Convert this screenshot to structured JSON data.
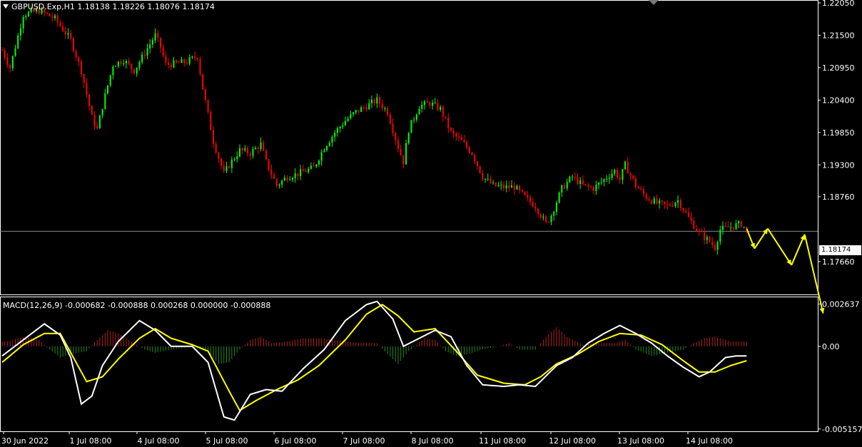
{
  "header": {
    "symbol_line": "GBPUSD.Exp,H1  1.18138 1.18226 1.18076 1.18174"
  },
  "macd_header": "MACD(12,26,9) -0.000682 -0.000888 0.000268 0.000000 -0.000888",
  "current_price_label": "1.18174",
  "colors": {
    "background": "#000000",
    "bull": "#00ff00",
    "bear": "#ff0000",
    "grid_frame": "#ffffff",
    "macd_line": "#ffffff",
    "signal_line": "#ffff00",
    "hist_pos": "#b22222",
    "hist_neg": "#228b22",
    "projection": "#ffff00"
  },
  "chart_data": [
    {
      "type": "candlestick",
      "title": "GBPUSD.Exp,H1",
      "y_ticks": [
        "1.22050",
        "1.21500",
        "1.20950",
        "1.20400",
        "1.19850",
        "1.19300",
        "1.18760",
        "1.17660"
      ],
      "ylim": [
        1.1715,
        1.2205
      ],
      "x_ticks": [
        "30 Jun 2022",
        "1 Jul 08:00",
        "4 Jul 08:00",
        "5 Jul 08:00",
        "6 Jul 08:00",
        "7 Jul 08:00",
        "8 Jul 08:00",
        "11 Jul 08:00",
        "12 Jul 08:00",
        "13 Jul 08:00",
        "14 Jul 08:00"
      ],
      "current_price": 1.18174,
      "close_path": [
        [
          0,
          1.2125
        ],
        [
          3,
          1.2095
        ],
        [
          8,
          1.2185
        ],
        [
          14,
          1.2192
        ],
        [
          20,
          1.2178
        ],
        [
          26,
          1.2142
        ],
        [
          30,
          1.209
        ],
        [
          34,
          1.201
        ],
        [
          36,
          1.199
        ],
        [
          38,
          1.203
        ],
        [
          42,
          1.21
        ],
        [
          46,
          1.2108
        ],
        [
          50,
          1.209
        ],
        [
          54,
          1.212
        ],
        [
          58,
          1.215
        ],
        [
          60,
          1.213
        ],
        [
          62,
          1.21
        ],
        [
          66,
          1.2102
        ],
        [
          70,
          1.2105
        ],
        [
          74,
          1.2115
        ],
        [
          76,
          1.206
        ],
        [
          80,
          1.197
        ],
        [
          84,
          1.1915
        ],
        [
          86,
          1.193
        ],
        [
          90,
          1.1955
        ],
        [
          94,
          1.195
        ],
        [
          98,
          1.1965
        ],
        [
          100,
          1.1935
        ],
        [
          104,
          1.1895
        ],
        [
          108,
          1.191
        ],
        [
          112,
          1.1915
        ],
        [
          118,
          1.1925
        ],
        [
          122,
          1.196
        ],
        [
          126,
          1.1985
        ],
        [
          130,
          1.2005
        ],
        [
          134,
          1.202
        ],
        [
          138,
          1.203
        ],
        [
          142,
          1.204
        ],
        [
          146,
          1.202
        ],
        [
          150,
          1.196
        ],
        [
          152,
          1.1935
        ],
        [
          154,
          1.199
        ],
        [
          158,
          1.203
        ],
        [
          162,
          1.2035
        ],
        [
          166,
          1.2025
        ],
        [
          170,
          1.1985
        ],
        [
          174,
          1.197
        ],
        [
          178,
          1.195
        ],
        [
          182,
          1.191
        ],
        [
          186,
          1.1895
        ],
        [
          190,
          1.1892
        ],
        [
          194,
          1.1893
        ],
        [
          198,
          1.1875
        ],
        [
          202,
          1.186
        ],
        [
          206,
          1.183
        ],
        [
          208,
          1.1845
        ],
        [
          212,
          1.189
        ],
        [
          216,
          1.191
        ],
        [
          220,
          1.1895
        ],
        [
          224,
          1.189
        ],
        [
          228,
          1.1905
        ],
        [
          232,
          1.192
        ],
        [
          234,
          1.1905
        ],
        [
          236,
          1.193
        ],
        [
          240,
          1.1895
        ],
        [
          244,
          1.1875
        ],
        [
          248,
          1.1865
        ],
        [
          252,
          1.186
        ],
        [
          256,
          1.187
        ],
        [
          260,
          1.184
        ],
        [
          264,
          1.1815
        ],
        [
          268,
          1.18
        ],
        [
          270,
          1.179
        ],
        [
          272,
          1.182
        ],
        [
          276,
          1.1825
        ],
        [
          280,
          1.183
        ],
        [
          282,
          1.182
        ]
      ],
      "projection_points": [
        [
          282,
          1.1822
        ],
        [
          285,
          1.1788
        ],
        [
          290,
          1.1822
        ],
        [
          299,
          1.176
        ],
        [
          304,
          1.1812
        ],
        [
          311,
          1.1678
        ]
      ]
    },
    {
      "type": "line",
      "title": "MACD(12,26,9)",
      "y_ticks": [
        "0.002637",
        "0.00",
        "-0.005157"
      ],
      "ylim": [
        -0.0053,
        0.0031
      ],
      "series": [
        {
          "name": "MACD",
          "values": [
            [
              0,
              -0.0006
            ],
            [
              8,
              0.0004
            ],
            [
              16,
              0.0014
            ],
            [
              22,
              0.0007
            ],
            [
              26,
              -0.0007
            ],
            [
              30,
              -0.0036
            ],
            [
              34,
              -0.0031
            ],
            [
              38,
              -0.0012
            ],
            [
              44,
              0.0003
            ],
            [
              52,
              0.0016
            ],
            [
              58,
              0.001
            ],
            [
              64,
              0.0
            ],
            [
              72,
              0.0
            ],
            [
              78,
              -0.001
            ],
            [
              84,
              -0.0044
            ],
            [
              88,
              -0.0046
            ],
            [
              94,
              -0.003
            ],
            [
              100,
              -0.0027
            ],
            [
              106,
              -0.0028
            ],
            [
              114,
              -0.0014
            ],
            [
              122,
              -0.0002
            ],
            [
              130,
              0.0016
            ],
            [
              138,
              0.0026
            ],
            [
              142,
              0.0028
            ],
            [
              148,
              0.0017
            ],
            [
              152,
              0.0
            ],
            [
              158,
              0.0005
            ],
            [
              164,
              0.001
            ],
            [
              170,
              0.0006
            ],
            [
              176,
              -0.0012
            ],
            [
              182,
              -0.0024
            ],
            [
              190,
              -0.0025
            ],
            [
              196,
              -0.0024
            ],
            [
              202,
              -0.0025
            ],
            [
              210,
              -0.0012
            ],
            [
              216,
              -0.0007
            ],
            [
              222,
              0.0002
            ],
            [
              228,
              0.0008
            ],
            [
              234,
              0.0013
            ],
            [
              240,
              0.0008
            ],
            [
              246,
              0.0002
            ],
            [
              252,
              -0.0006
            ],
            [
              258,
              -0.0013
            ],
            [
              264,
              -0.0019
            ],
            [
              268,
              -0.0016
            ],
            [
              274,
              -0.0007
            ],
            [
              278,
              -0.0006
            ],
            [
              282,
              -0.0006
            ]
          ]
        },
        {
          "name": "Signal",
          "values": [
            [
              0,
              -0.001
            ],
            [
              8,
              0.0001
            ],
            [
              16,
              0.0008
            ],
            [
              22,
              0.0008
            ],
            [
              28,
              -0.001
            ],
            [
              32,
              -0.0022
            ],
            [
              38,
              -0.0019
            ],
            [
              44,
              -0.0008
            ],
            [
              52,
              0.0005
            ],
            [
              58,
              0.0011
            ],
            [
              64,
              0.0005
            ],
            [
              72,
              0.0001
            ],
            [
              78,
              -0.0003
            ],
            [
              86,
              -0.0028
            ],
            [
              90,
              -0.004
            ],
            [
              96,
              -0.0034
            ],
            [
              104,
              -0.0027
            ],
            [
              112,
              -0.0021
            ],
            [
              120,
              -0.0012
            ],
            [
              130,
              0.0004
            ],
            [
              138,
              0.002
            ],
            [
              144,
              0.0026
            ],
            [
              150,
              0.0019
            ],
            [
              156,
              0.0009
            ],
            [
              164,
              0.0011
            ],
            [
              172,
              -0.0003
            ],
            [
              180,
              -0.0018
            ],
            [
              190,
              -0.0023
            ],
            [
              198,
              -0.0024
            ],
            [
              204,
              -0.0019
            ],
            [
              210,
              -0.0011
            ],
            [
              218,
              -0.0005
            ],
            [
              226,
              0.0003
            ],
            [
              234,
              0.0008
            ],
            [
              242,
              0.0007
            ],
            [
              250,
              0.0001
            ],
            [
              258,
              -0.0009
            ],
            [
              264,
              -0.0016
            ],
            [
              270,
              -0.0016
            ],
            [
              276,
              -0.0012
            ],
            [
              282,
              -0.0009
            ]
          ]
        },
        {
          "name": "Histogram",
          "values": [
            [
              2,
              0.0003
            ],
            [
              6,
              0.0005
            ],
            [
              10,
              0.0006
            ],
            [
              14,
              0.0004
            ],
            [
              18,
              -0.0002
            ],
            [
              22,
              -0.0007
            ],
            [
              26,
              -0.0005
            ],
            [
              32,
              -0.0003
            ],
            [
              36,
              0.0004
            ],
            [
              40,
              0.001
            ],
            [
              44,
              0.0008
            ],
            [
              48,
              0.0004
            ],
            [
              54,
              -0.0002
            ],
            [
              58,
              -0.0004
            ],
            [
              64,
              -0.0002
            ],
            [
              72,
              0.0
            ],
            [
              78,
              -0.0004
            ],
            [
              82,
              -0.0011
            ],
            [
              86,
              -0.001
            ],
            [
              90,
              -0.0002
            ],
            [
              94,
              0.0004
            ],
            [
              98,
              0.0006
            ],
            [
              102,
              0.0002
            ],
            [
              108,
              0.0003
            ],
            [
              114,
              0.0005
            ],
            [
              120,
              0.0005
            ],
            [
              126,
              0.0004
            ],
            [
              130,
              0.0003
            ],
            [
              136,
              0.0002
            ],
            [
              142,
              0.0002
            ],
            [
              146,
              -0.0005
            ],
            [
              150,
              -0.0011
            ],
            [
              154,
              -0.0003
            ],
            [
              160,
              0.0005
            ],
            [
              164,
              0.0004
            ],
            [
              168,
              -0.0003
            ],
            [
              172,
              -0.0006
            ],
            [
              176,
              -0.0005
            ],
            [
              182,
              -0.0002
            ],
            [
              188,
              0.0
            ],
            [
              192,
              0.0002
            ],
            [
              196,
              -0.0002
            ],
            [
              202,
              -0.0002
            ],
            [
              206,
              0.0006
            ],
            [
              210,
              0.0012
            ],
            [
              214,
              0.0006
            ],
            [
              220,
              0.0001
            ],
            [
              226,
              0.0002
            ],
            [
              232,
              0.0002
            ],
            [
              236,
              0.0004
            ],
            [
              240,
              -0.0002
            ],
            [
              246,
              -0.0006
            ],
            [
              252,
              -0.0004
            ],
            [
              258,
              -0.0002
            ],
            [
              262,
              0.0002
            ],
            [
              266,
              0.0005
            ],
            [
              270,
              0.0006
            ],
            [
              276,
              0.0003
            ]
          ]
        }
      ]
    }
  ]
}
